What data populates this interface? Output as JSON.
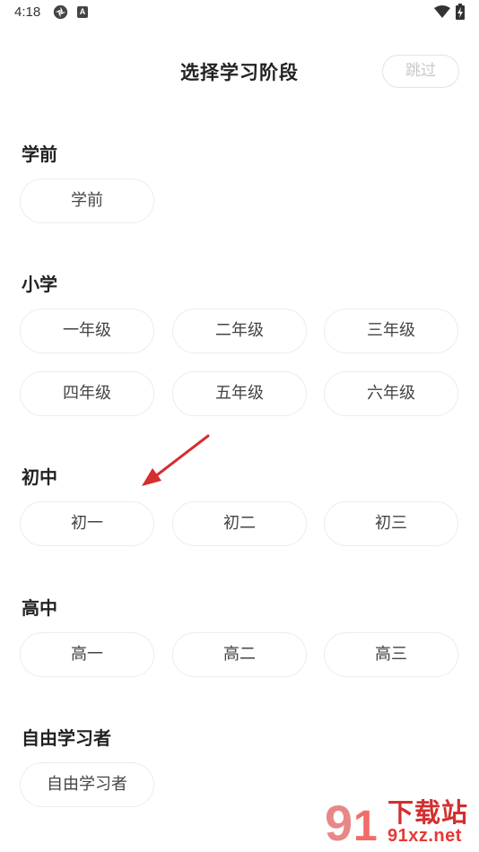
{
  "status_bar": {
    "time": "4:18",
    "notification_letter": "A"
  },
  "header": {
    "title": "选择学习阶段",
    "skip_label": "跳过"
  },
  "sections": [
    {
      "title": "学前",
      "buttons": [
        "学前"
      ]
    },
    {
      "title": "小学",
      "buttons": [
        "一年级",
        "二年级",
        "三年级",
        "四年级",
        "五年级",
        "六年级"
      ]
    },
    {
      "title": "初中",
      "buttons": [
        "初一",
        "初二",
        "初三"
      ]
    },
    {
      "title": "高中",
      "buttons": [
        "高一",
        "高二",
        "高三"
      ]
    },
    {
      "title": "自由学习者",
      "buttons": [
        "自由学习者"
      ]
    }
  ],
  "watermark": {
    "name": "下载站",
    "url": "91xz.net"
  },
  "colors": {
    "accent_red": "#d32f2f",
    "button_border": "#ececec",
    "skip_text": "#c8c8c8"
  }
}
